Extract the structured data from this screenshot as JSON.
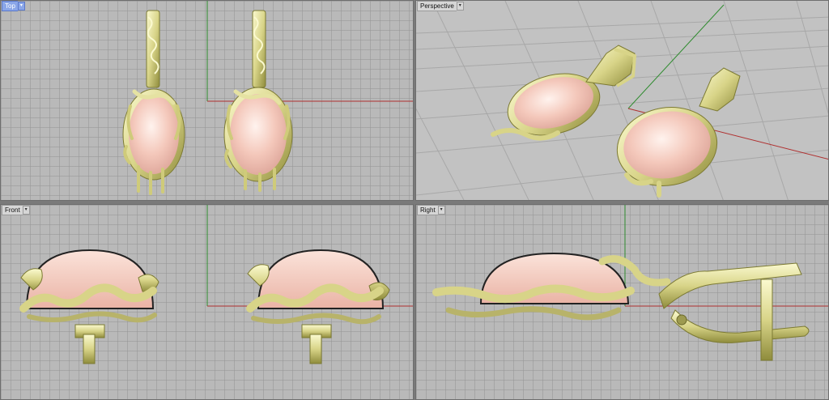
{
  "viewports": {
    "top": {
      "label": "Top",
      "menu_icon": "dropdown-arrow-icon",
      "active": true
    },
    "perspective": {
      "label": "Perspective",
      "menu_icon": "dropdown-arrow-icon",
      "active": false
    },
    "front": {
      "label": "Front",
      "menu_icon": "dropdown-arrow-icon",
      "active": false
    },
    "right": {
      "label": "Right",
      "menu_icon": "dropdown-arrow-icon",
      "active": false
    }
  },
  "colors": {
    "viewport_bg": "#b9b9b9",
    "grid_line": "#969696",
    "x_axis": "#b03030",
    "y_axis": "#2e8b2e",
    "gold": "#e8e6a0",
    "gold_shadow": "#8f8c3c",
    "stone": "#f3c5b8",
    "active_tab": "#8aa6e8"
  }
}
